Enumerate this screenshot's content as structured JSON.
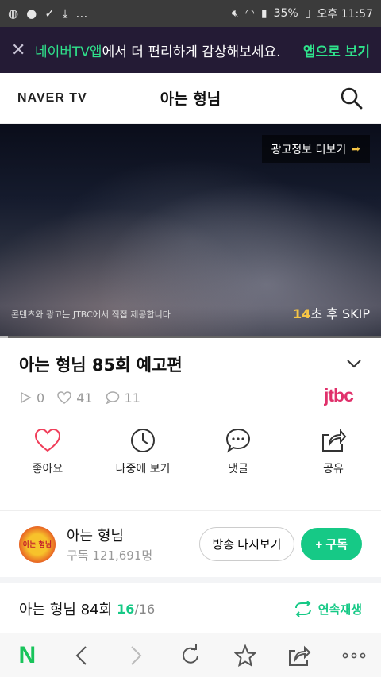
{
  "status": {
    "battery": "35%",
    "time": "오후 11:57"
  },
  "banner": {
    "close_glyph": "✕",
    "highlight": "네이버TV앱",
    "message": "에서 더 편리하게 감상해보세요.",
    "open_app": "앱으로 보기"
  },
  "header": {
    "logo": "NAVER TV",
    "title": "아는 형님"
  },
  "video": {
    "ad_info": "광고정보 더보기",
    "provider_notice": "콘텐츠와 광고는 JTBC에서 직접 제공합니다",
    "skip_seconds": "14",
    "skip_label": "초 후 SKIP"
  },
  "clip": {
    "title": "아는 형님 85회 예고편",
    "plays": "0",
    "likes": "41",
    "comments": "11",
    "broadcaster": "jtbc"
  },
  "actions": [
    {
      "label": "좋아요"
    },
    {
      "label": "나중에 보기"
    },
    {
      "label": "댓글"
    },
    {
      "label": "공유"
    }
  ],
  "channel": {
    "name": "아는 형님",
    "subscribers": "구독 121,691명",
    "replay_button": "방송 다시보기",
    "subscribe_button": "+ 구독"
  },
  "playlist": {
    "title": "아는 형님 84회",
    "current": "16",
    "total": "/16",
    "autoplay": "연속재생"
  },
  "colors": {
    "accent": "#16c986",
    "banner_bg": "#241b35",
    "skip_highlight": "#f6c545"
  }
}
